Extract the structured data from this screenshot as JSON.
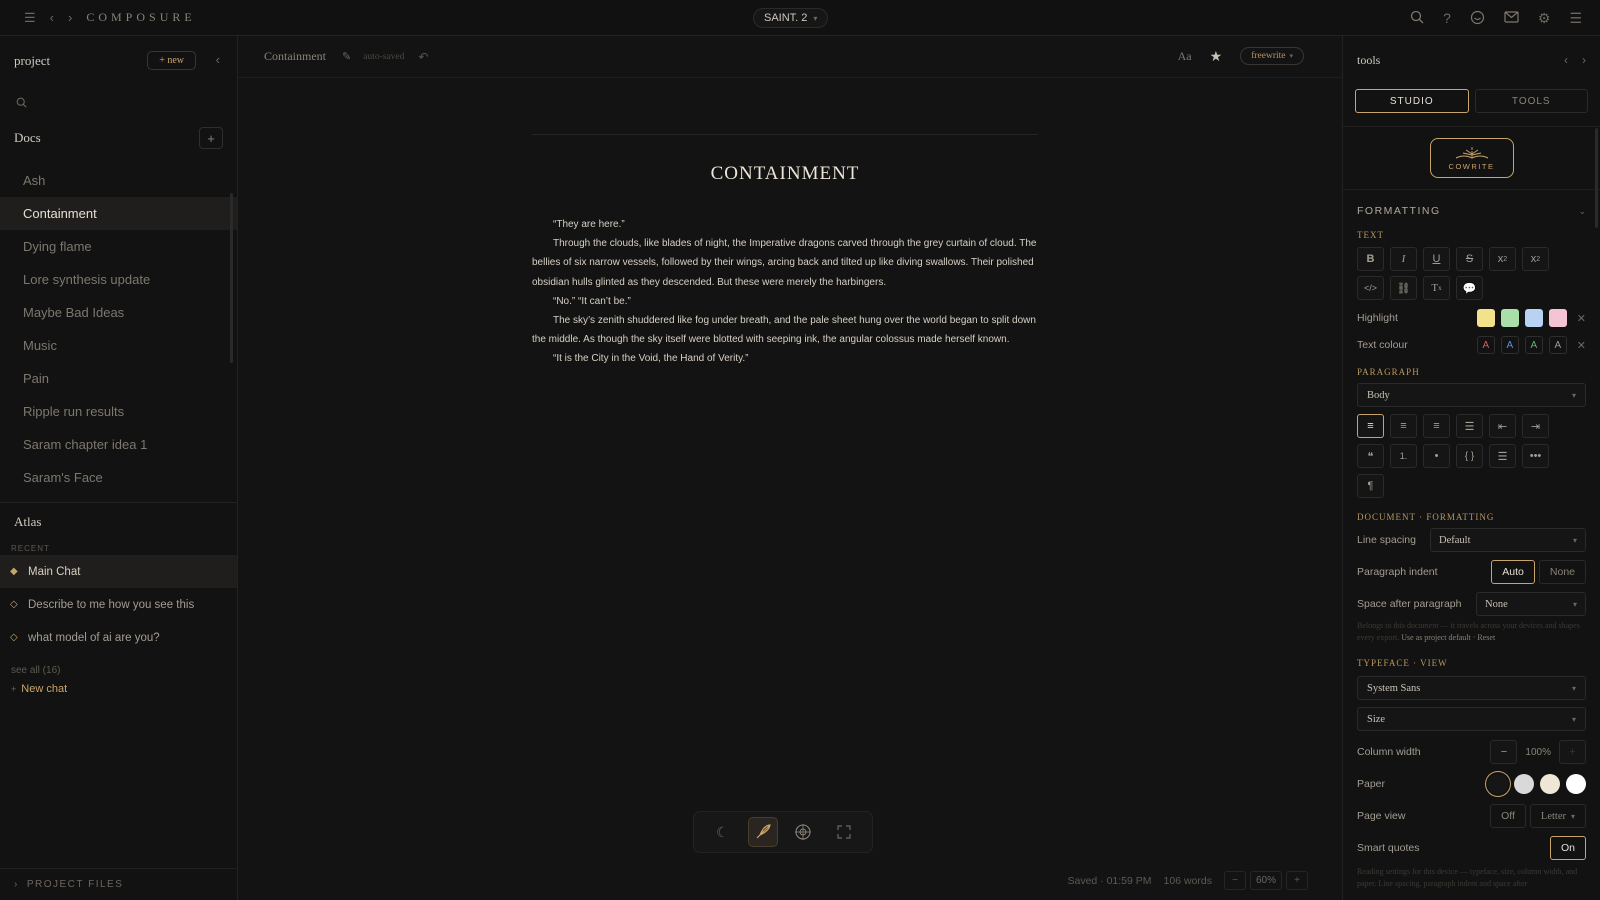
{
  "app": {
    "brand": "COMPOSURE",
    "project": "SAINT. 2"
  },
  "left": {
    "title": "project",
    "new_label": "+ new",
    "docs_label": "Docs",
    "docs": [
      "Ash",
      "Containment",
      "Dying flame",
      "Lore synthesis update",
      "Maybe Bad Ideas",
      "Music",
      "Pain",
      "Ripple run results",
      "Saram chapter idea 1",
      "Saram's Face"
    ],
    "active_doc": "Containment",
    "atlas_label": "Atlas",
    "recent_label": "RECENT",
    "chats": [
      "Main Chat",
      "Describe to me how you see this",
      "what model of ai are you?"
    ],
    "see_all": "see all (16)",
    "new_chat": "New chat",
    "project_files": "PROJECT FILES"
  },
  "editor": {
    "doc_name": "Containment",
    "autosaved": "auto-saved",
    "font_toggle": "Aa",
    "mode": "freewrite",
    "title": "CONTAINMENT",
    "paragraphs": [
      "“They are here.”",
      "Through the clouds, like blades of night, the Imperative dragons carved through the grey curtain of cloud. The bellies of six narrow vessels, followed by their wings, arcing back and tilted up like diving swallows. Their polished obsidian hulls glinted as they descended. But these were merely the harbingers.",
      "“No.” “It can’t be.”",
      "The sky’s zenith shuddered like fog under breath, and the pale sheet hung over the world began to split down the middle. As though the sky itself were blotted with seeping ink, the angular colossus made herself known.",
      "“It is the City in the Void, the Hand of Verity.”"
    ],
    "status": {
      "saved": "Saved · 01:59 PM",
      "words": "106 words",
      "zoom": "60%"
    }
  },
  "right": {
    "title": "tools",
    "tabs": [
      "STUDIO",
      "TOOLS"
    ],
    "cowrite": "COWRITE",
    "formatting": "FORMATTING",
    "text_label": "TEXT",
    "highlight_label": "Highlight",
    "text_colour_label": "Text colour",
    "highlight_colors": [
      "#f3e28b",
      "#a9dfa9",
      "#b7d2f2",
      "#f4c4d4"
    ],
    "text_colors": [
      "#d85a5a",
      "#5b8ee0",
      "#5fb86b",
      "#9a9a9a"
    ],
    "paragraph_label": "PARAGRAPH",
    "paragraph_style": "Body",
    "doc_formatting_label": "DOCUMENT · FORMATTING",
    "line_spacing_label": "Line spacing",
    "line_spacing": "Default",
    "paragraph_indent_label": "Paragraph indent",
    "indent_options": [
      "Auto",
      "None"
    ],
    "space_after_label": "Space after paragraph",
    "space_after": "None",
    "note_text": "Belongs to this document — it travels across your devices and shapes every export.",
    "note_link_default": "Use as project default",
    "note_link_reset": "Reset",
    "typeface_label": "TYPEFACE · VIEW",
    "typeface": "System Sans",
    "size": "Size",
    "column_width_label": "Column width",
    "column_width": "100%",
    "paper_label": "Paper",
    "paper_colors": [
      "#161616",
      "#d9d9d9",
      "#efe7d6",
      "#ffffff"
    ],
    "page_view_label": "Page view",
    "page_view": "Off",
    "page_size": "Letter",
    "smart_quotes_label": "Smart quotes",
    "smart_quotes": "On",
    "reading_note": "Reading settings for this device — typeface, size, column width, and paper. Line spacing, paragraph indent and space after"
  }
}
